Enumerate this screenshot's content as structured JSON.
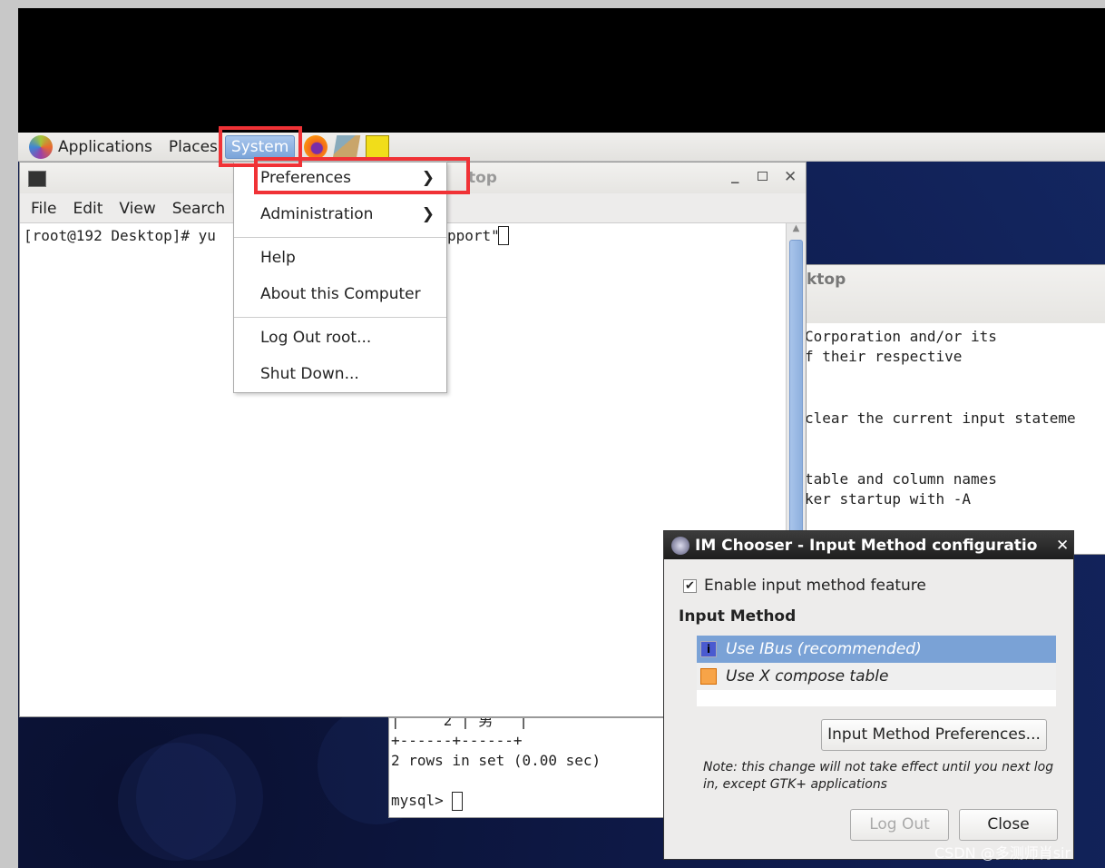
{
  "panel": {
    "items": [
      "Applications",
      "Places",
      "System"
    ],
    "launchers": [
      "firefox-icon",
      "screenshot-icon",
      "notes-icon"
    ]
  },
  "terminal_main": {
    "title": "top",
    "menu": [
      "File",
      "Edit",
      "View",
      "Search"
    ],
    "line": "[root@192 Desktop]# yu",
    "line_tail": "pport\""
  },
  "terminal_back": {
    "title": "ktop",
    "lines": [
      "Corporation and/or its",
      "f their respective",
      "",
      "",
      "clear the current input stateme",
      "",
      "",
      "table and column names",
      "ker startup with -A"
    ]
  },
  "mysql_terminal": {
    "lines": [
      "|     2 | 男   |",
      "+------+------+",
      "2 rows in set (0.00 sec)",
      "",
      "mysql> "
    ]
  },
  "system_menu": {
    "items": [
      {
        "label": "Preferences",
        "submenu": true
      },
      {
        "label": "Administration",
        "submenu": true
      },
      {
        "label": "Help"
      },
      {
        "label": "About this Computer"
      },
      {
        "label": "Log Out root..."
      },
      {
        "label": "Shut Down..."
      }
    ]
  },
  "dialog": {
    "title": "IM Chooser - Input Method configuratio",
    "checkbox_label": "Enable input method feature",
    "checked": true,
    "section": "Input Method",
    "options": [
      {
        "label": "Use IBus (recommended)",
        "selected": true
      },
      {
        "label": "Use X compose table",
        "selected": false
      }
    ],
    "prefs_button": "Input Method Preferences...",
    "note": "Note: this change will not take effect until you next log in, except GTK+ applications",
    "logout_button": "Log Out",
    "close_button": "Close"
  },
  "watermark": "CSDN @多测师肖sir",
  "colors": {
    "highlight": "#f03236",
    "selection": "#7aa2d6"
  }
}
